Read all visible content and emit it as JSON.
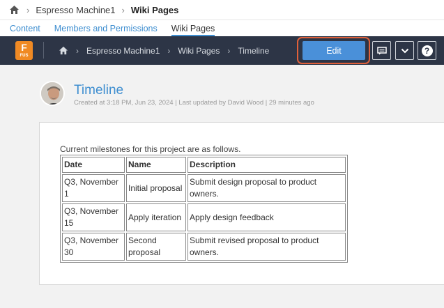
{
  "breadcrumb_top": {
    "items": [
      "Espresso Machine1",
      "Wiki Pages"
    ]
  },
  "tabs": [
    "Content",
    "Members and Permissions",
    "Wiki Pages"
  ],
  "header": {
    "logo_letter": "F",
    "logo_sub": "FUS",
    "nav": [
      "Espresso Machine1",
      "Wiki Pages",
      "Timeline"
    ],
    "edit_label": "Edit",
    "help_glyph": "?"
  },
  "page": {
    "title": "Timeline",
    "meta": "Created at 3:18 PM, Jun 23, 2024 | Last updated by David Wood | 29 minutes ago",
    "intro": "Current milestones for this project are as follows."
  },
  "table": {
    "headers": [
      "Date",
      "Name",
      "Description"
    ],
    "rows": [
      [
        "Q3, November 1",
        "Initial proposal",
        "Submit design proposal to product owners."
      ],
      [
        "Q3, November 15",
        "Apply iteration",
        "Apply design feedback"
      ],
      [
        "Q3, November 30",
        "Second proposal",
        "Submit revised proposal to product owners."
      ]
    ]
  },
  "colors": {
    "accent": "#3e8ed0",
    "dark_bar": "#2d3546",
    "edit_button": "#4a90d9",
    "highlight": "#e0603a",
    "logo": "#f08a24"
  }
}
